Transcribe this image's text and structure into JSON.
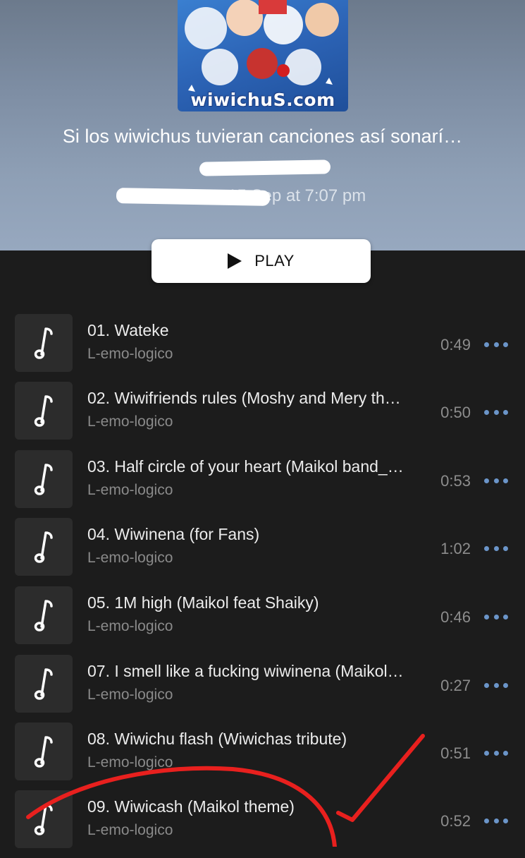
{
  "playlist": {
    "title": "Si los wiwichus tuvieran canciones así sonarí…",
    "owner": "",
    "updated": "15 Sep at 7:07 pm",
    "cover_logo": "wiwichuS.com"
  },
  "play_button": {
    "label": "PLAY",
    "icon": "play-icon"
  },
  "tracks": [
    {
      "name": "01. Wateke",
      "artist": "L-emo-logico",
      "duration": "0:49"
    },
    {
      "name": "02. Wiwifriends rules (Moshy and Mery th…",
      "artist": "L-emo-logico",
      "duration": "0:50"
    },
    {
      "name": "03. Half circle of your heart (Maikol band_…",
      "artist": "L-emo-logico",
      "duration": "0:53"
    },
    {
      "name": "04. Wiwinena (for Fans)",
      "artist": "L-emo-logico",
      "duration": "1:02"
    },
    {
      "name": "05. 1M high (Maikol feat Shaiky)",
      "artist": "L-emo-logico",
      "duration": "0:46"
    },
    {
      "name": "07. I smell like a fucking wiwinena (Maikol…",
      "artist": "L-emo-logico",
      "duration": "0:27"
    },
    {
      "name": "08. Wiwichu flash (Wiwichas tribute)",
      "artist": "L-emo-logico",
      "duration": "0:51"
    },
    {
      "name": "09. Wiwicash (Maikol theme)",
      "artist": "L-emo-logico",
      "duration": "0:52"
    }
  ],
  "icons": {
    "track": "music-note-icon",
    "more": "more-horizontal-icon"
  },
  "colors": {
    "background": "#1c1c1c",
    "header_gradient": "#7d8da3",
    "accent_dots": "#6b95c9",
    "annotation_red": "#e8201e"
  }
}
